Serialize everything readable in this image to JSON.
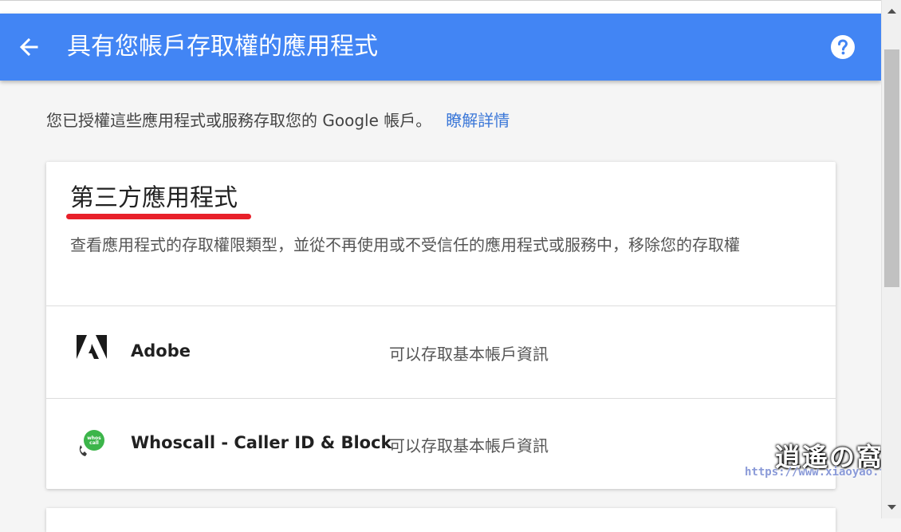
{
  "header": {
    "title": "具有您帳戶存取權的應用程式",
    "back_icon": "arrow-back-icon",
    "help_icon": "help-icon",
    "background_color": "#4285f4"
  },
  "intro": {
    "text": "您已授權這些應用程式或服務存取您的 Google 帳戶。",
    "link": "瞭解詳情",
    "link_color": "#3c78d8"
  },
  "third_party": {
    "title": "第三方應用程式",
    "underline_color": "#e8202a",
    "description": "查看應用程式的存取權限類型，並從不再使用或不受信任的應用程式或服務中，移除您的存取權",
    "apps": [
      {
        "name": "Adobe",
        "access": "可以存取基本帳戶資訊",
        "icon": "adobe-logo-icon"
      },
      {
        "name": "Whoscall - Caller ID & Block",
        "access": "可以存取基本帳戶資訊",
        "icon": "whoscall-logo-icon",
        "icon_text": "whos call"
      }
    ]
  },
  "watermark": {
    "logo": "逍遙の窩",
    "url": "https://www.xiaoyao.tw/"
  }
}
